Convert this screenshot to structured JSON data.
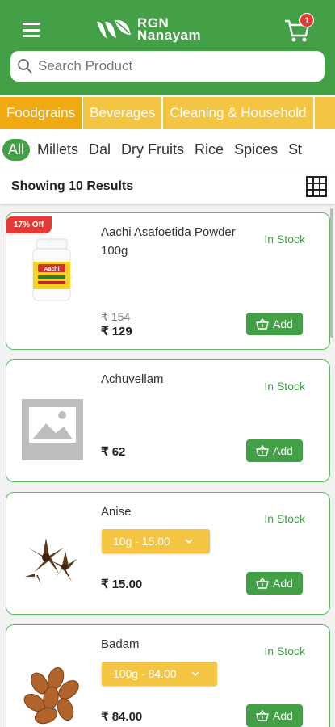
{
  "header": {
    "brand_line1": "RGN",
    "brand_line2": "Nanayam",
    "cart_count": "1",
    "search_placeholder": "Search Product",
    "brand_color": "#43a047"
  },
  "categories": [
    {
      "label": "Foodgrains",
      "active": true
    },
    {
      "label": "Beverages",
      "active": false
    },
    {
      "label": "Cleaning & Household",
      "active": false
    }
  ],
  "subcategories": [
    {
      "label": "All",
      "active": true
    },
    {
      "label": "Millets",
      "active": false
    },
    {
      "label": "Dal",
      "active": false
    },
    {
      "label": "Dry Fruits",
      "active": false
    },
    {
      "label": "Rice",
      "active": false
    },
    {
      "label": "Spices",
      "active": false
    },
    {
      "label": "St",
      "active": false
    }
  ],
  "results": {
    "text": "Showing 10 Results",
    "view_icon": "grid-icon"
  },
  "products": [
    {
      "name": "Aachi Asafoetida Powder 100g",
      "stock": "In Stock",
      "discount": "17% Off",
      "mrp": "₹ 154",
      "price": "₹ 129",
      "add_label": "Add",
      "image": "asafoetida-jar"
    },
    {
      "name": "Achuvellam",
      "stock": "In Stock",
      "price": "₹ 62",
      "add_label": "Add",
      "image": "placeholder-image"
    },
    {
      "name": "Anise",
      "stock": "In Stock",
      "variant": "10g - 15.00",
      "price": "₹ 15.00",
      "add_label": "Add",
      "image": "star-anise"
    },
    {
      "name": "Badam",
      "stock": "In Stock",
      "variant": "100g - 84.00",
      "price": "₹ 84.00",
      "add_label": "Add",
      "image": "almonds"
    }
  ]
}
